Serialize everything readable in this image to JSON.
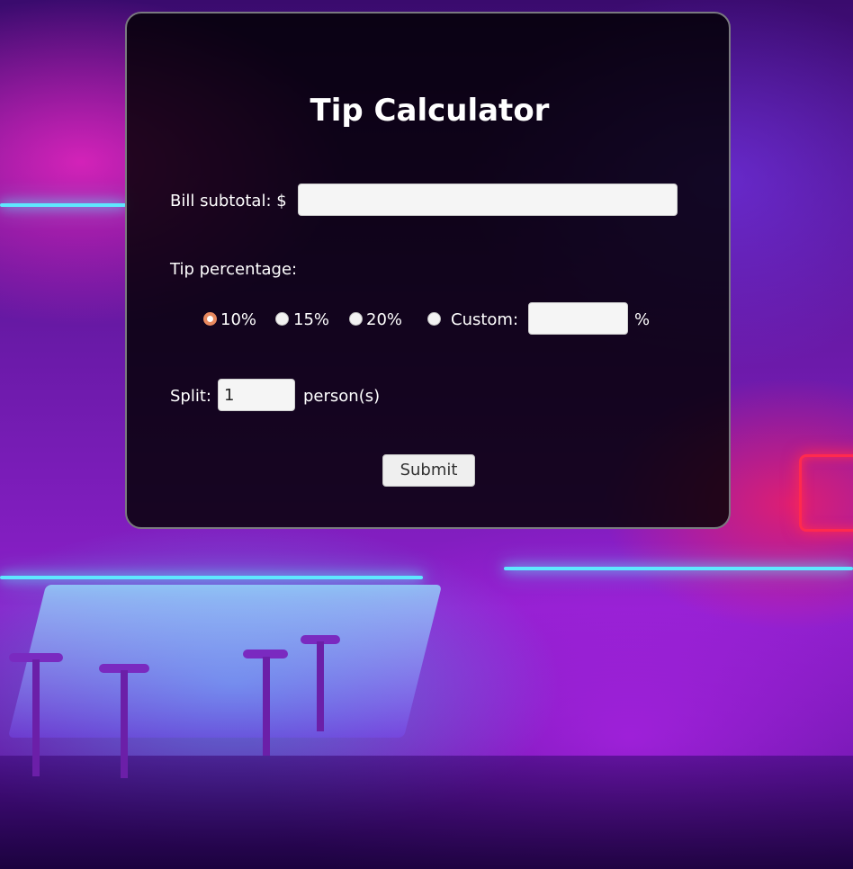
{
  "title": "Tip Calculator",
  "bill": {
    "label": "Bill subtotal: $",
    "value": ""
  },
  "tip": {
    "label": "Tip percentage:",
    "options": [
      {
        "label": "10%",
        "checked": true
      },
      {
        "label": "15%",
        "checked": false
      },
      {
        "label": "20%",
        "checked": false
      },
      {
        "label": "Custom:",
        "checked": false
      }
    ],
    "custom_value": "",
    "custom_suffix": "%"
  },
  "split": {
    "label": "Split:",
    "value": "1",
    "suffix": "person(s)"
  },
  "submit_label": "Submit",
  "colors": {
    "card_background": "#000000",
    "radio_checked": "#e8895f",
    "text": "#ffffff"
  }
}
